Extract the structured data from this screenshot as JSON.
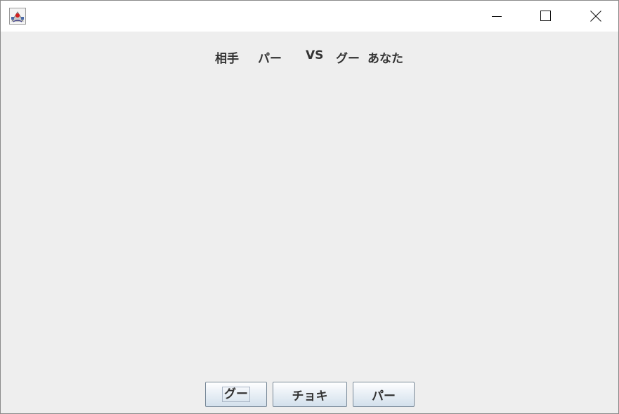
{
  "titlebar": {
    "icons": {
      "app": "java-cup-icon",
      "minimize": "minimize-icon",
      "maximize": "maximize-icon",
      "close": "close-icon"
    }
  },
  "status": {
    "opponent_label": "相手",
    "opponent_hand": "パー",
    "vs": "VS",
    "player_hand": "グー",
    "player_label": "あなた"
  },
  "buttons": {
    "gu": "グー",
    "choki": "チョキ",
    "pa": "パー"
  },
  "colors": {
    "window_bg": "#eeeeee",
    "titlebar_bg": "#ffffff",
    "text": "#333333",
    "button_border": "#7a8a99"
  }
}
